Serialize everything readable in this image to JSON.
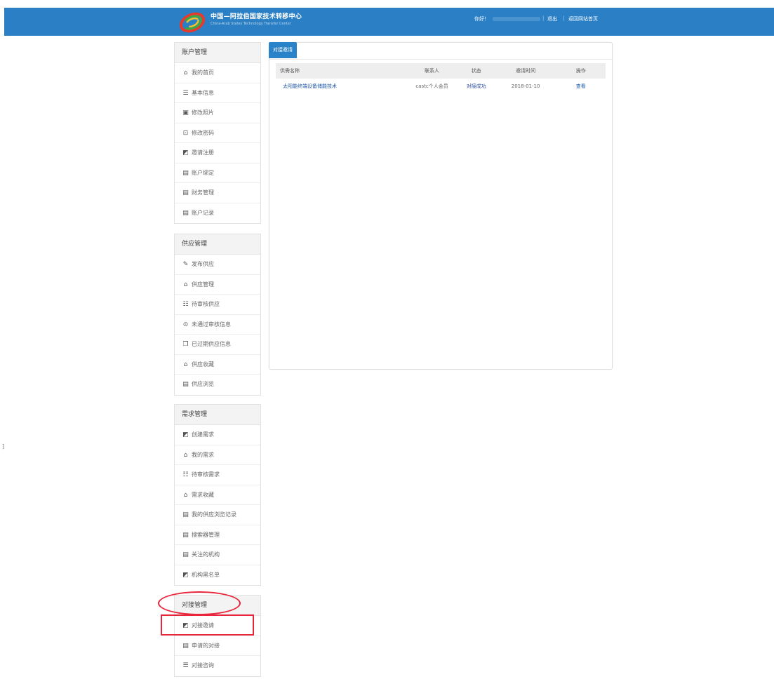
{
  "header": {
    "brand_cn": "中国—阿拉伯国家技术转移中心",
    "brand_en": "China-Arab States Technology Transfer Center",
    "greeting": "你好！",
    "logout": "退出",
    "back_home": "返回网站首页",
    "separator": "|"
  },
  "sidebar": {
    "account": {
      "title": "账户管理",
      "items": [
        {
          "icon": "⌂",
          "label": "我的首页"
        },
        {
          "icon": "☰",
          "label": "基本信息"
        },
        {
          "icon": "▣",
          "label": "修改照片"
        },
        {
          "icon": "⊡",
          "label": "修改密码"
        },
        {
          "icon": "◩",
          "label": "邀请注册"
        },
        {
          "icon": "▤",
          "label": "账户绑定"
        },
        {
          "icon": "▤",
          "label": "财务管理"
        },
        {
          "icon": "▤",
          "label": "账户记录"
        }
      ]
    },
    "supply": {
      "title": "供应管理",
      "items": [
        {
          "icon": "✎",
          "label": "发布供应"
        },
        {
          "icon": "⌂",
          "label": "供应管理"
        },
        {
          "icon": "☷",
          "label": "待审核供应"
        },
        {
          "icon": "⊙",
          "label": "未通过审核信息"
        },
        {
          "icon": "❐",
          "label": "已过期供应信息"
        },
        {
          "icon": "⌂",
          "label": "供应收藏"
        },
        {
          "icon": "▤",
          "label": "供应浏览"
        }
      ]
    },
    "demand": {
      "title": "需求管理",
      "items": [
        {
          "icon": "◩",
          "label": "创建需求"
        },
        {
          "icon": "⌂",
          "label": "我的需求"
        },
        {
          "icon": "☷",
          "label": "待审核需求"
        },
        {
          "icon": "⌂",
          "label": "需求收藏"
        },
        {
          "icon": "▤",
          "label": "我的供应浏览记录"
        },
        {
          "icon": "▤",
          "label": "搜索器管理"
        },
        {
          "icon": "▤",
          "label": "关注的机构"
        },
        {
          "icon": "◩",
          "label": "机构黑名单"
        }
      ]
    },
    "docking": {
      "title": "对接管理",
      "items": [
        {
          "icon": "◩",
          "label": "对接邀请"
        },
        {
          "icon": "▤",
          "label": "申请的对接"
        },
        {
          "icon": "☰",
          "label": "对接咨询"
        }
      ]
    }
  },
  "main": {
    "tab": "对接邀请",
    "table": {
      "headers": [
        "供需名称",
        "联系人",
        "状态",
        "邀请时间",
        "操作"
      ],
      "rows": [
        {
          "name": "太阳能终端设备储能技术",
          "contact": "castc个人会员",
          "status": "对接成功",
          "time": "2018-01-10",
          "action": "查看"
        }
      ]
    }
  },
  "colors": {
    "header_blue": "#2a7fc5",
    "tab_blue": "#2a83c8",
    "annotation_red": "#e8263b"
  }
}
